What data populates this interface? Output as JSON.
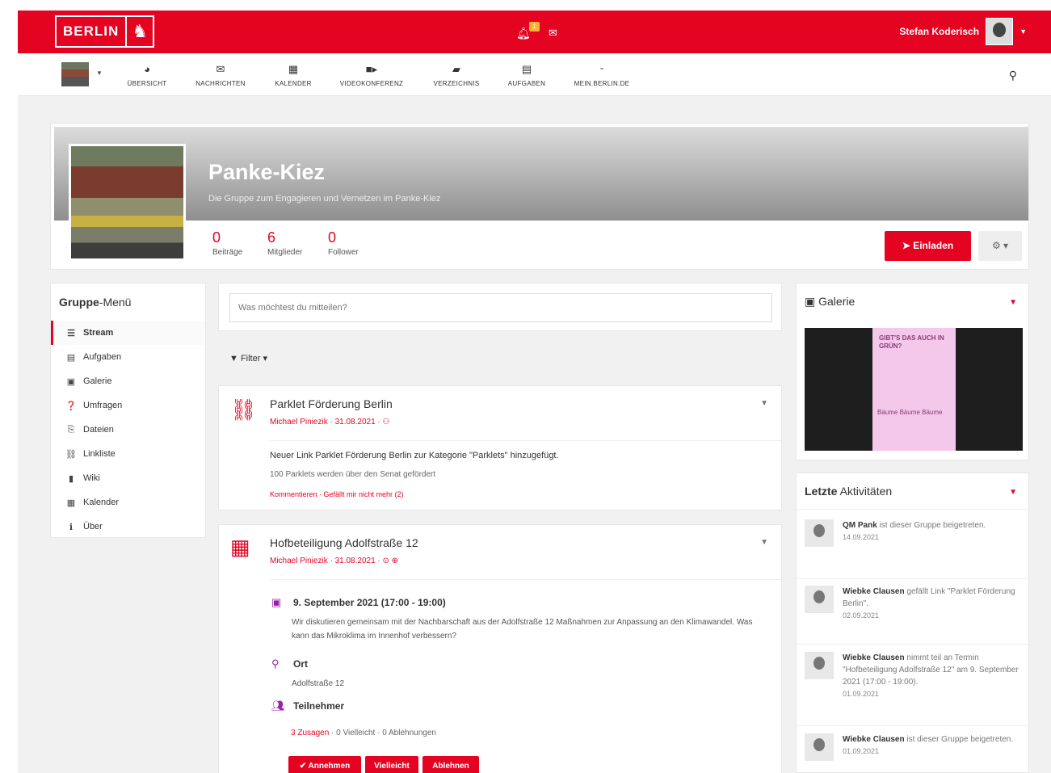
{
  "topbar": {
    "logo_text": "BERLIN",
    "notif_count": "1",
    "user_name": "Stefan Koderisch"
  },
  "nav": {
    "items": [
      {
        "label": "ÜBERSICHT",
        "icon": "dashboard-icon"
      },
      {
        "label": "NACHRICHTEN",
        "icon": "envelope-icon"
      },
      {
        "label": "KALENDER",
        "icon": "calendar-icon"
      },
      {
        "label": "VIDEOKONFERENZ",
        "icon": "video-icon"
      },
      {
        "label": "VERZEICHNIS",
        "icon": "book-icon"
      },
      {
        "label": "AUFGABEN",
        "icon": "tasks-icon"
      },
      {
        "label": "MEIN.BERLIN.DE",
        "icon": "chevron-down-icon"
      }
    ]
  },
  "group": {
    "name": "Panke-Kiez",
    "description": "Die Gruppe zum Engagieren und Vernetzen im Panke-Kiez",
    "stats": [
      {
        "value": "0",
        "label": "Beiträge"
      },
      {
        "value": "6",
        "label": "Mitglieder"
      },
      {
        "value": "0",
        "label": "Follower"
      }
    ],
    "invite_label": "Einladen",
    "settings_label": "⚙ ▾"
  },
  "menu": {
    "title_bold": "Gruppe",
    "title_rest": "-Menü",
    "items": [
      {
        "label": "Stream",
        "icon": "☰"
      },
      {
        "label": "Aufgaben",
        "icon": "▤"
      },
      {
        "label": "Galerie",
        "icon": "▣"
      },
      {
        "label": "Umfragen",
        "icon": "❓"
      },
      {
        "label": "Dateien",
        "icon": "⎘"
      },
      {
        "label": "Linkliste",
        "icon": "⛓"
      },
      {
        "label": "Wiki",
        "icon": "▮"
      },
      {
        "label": "Kalender",
        "icon": "▦"
      },
      {
        "label": "Über",
        "icon": "ℹ"
      }
    ]
  },
  "compose": {
    "placeholder": "Was möchtest du mitteilen?"
  },
  "filter_label": "▼ Filter ▾",
  "post1": {
    "title": "Parklet Förderung Berlin",
    "meta": "Michael Piniezik · 31.08.2021 · ⚇",
    "text": "Neuer Link Parklet Förderung Berlin zur Kategorie \"Parklets\" hinzugefügt.",
    "sub": "100 Parklets werden über den Senat gefördert",
    "links": "Kommentieren · Gefällt mir nicht mehr (2)"
  },
  "post2": {
    "title": "Hofbeteiligung Adolfstraße 12",
    "meta": "Michael Piniezik · 31.08.2021 · ⊙ ⊕",
    "event_title": "9. September 2021 (17:00 - 19:00)",
    "event_text": "Wir diskutieren gemeinsam mit der Nachbarschaft aus der Adolfstraße 12 Maßnahmen zur Anpassung an den Klimawandel. Was kann das Mikroklima im Innenhof verbessern?",
    "place_label": "Ort",
    "place": "Adolfstraße 12",
    "participants_label": "Teilnehmer",
    "reply_accept": "3 Zusagen",
    "reply_rest": " · 0 Vielleicht · 0 Ablehnungen",
    "btn_accept": "✔ Annehmen",
    "btn_maybe": "Vielleicht",
    "btn_decline": "Ablehnen"
  },
  "gallery": {
    "title": "Galerie",
    "poster_text": "GIBT'S DAS AUCH IN GRÜN?",
    "poster_words": "Bäume  Bäume  Bäume"
  },
  "activities": {
    "title_bold": "Letzte",
    "title_rest": " Aktivitäten",
    "items": [
      {
        "name": "QM Pank",
        "text": " ist dieser Gruppe beigetreten.",
        "date": "14.09.2021"
      },
      {
        "name": "Wiebke Clausen",
        "text": " gefällt Link \"Parklet Förderung Berlin\".",
        "date": "02.09.2021"
      },
      {
        "name": "Wiebke Clausen",
        "text": " nimmt teil an Termin \"Hofbeteiligung Adolfstraße 12\" am 9. September 2021 (17:00 - 19:00).",
        "date": "01.09.2021"
      },
      {
        "name": "Wiebke Clausen",
        "text": " ist dieser Gruppe beigetreten.",
        "date": "01.09.2021"
      }
    ]
  }
}
